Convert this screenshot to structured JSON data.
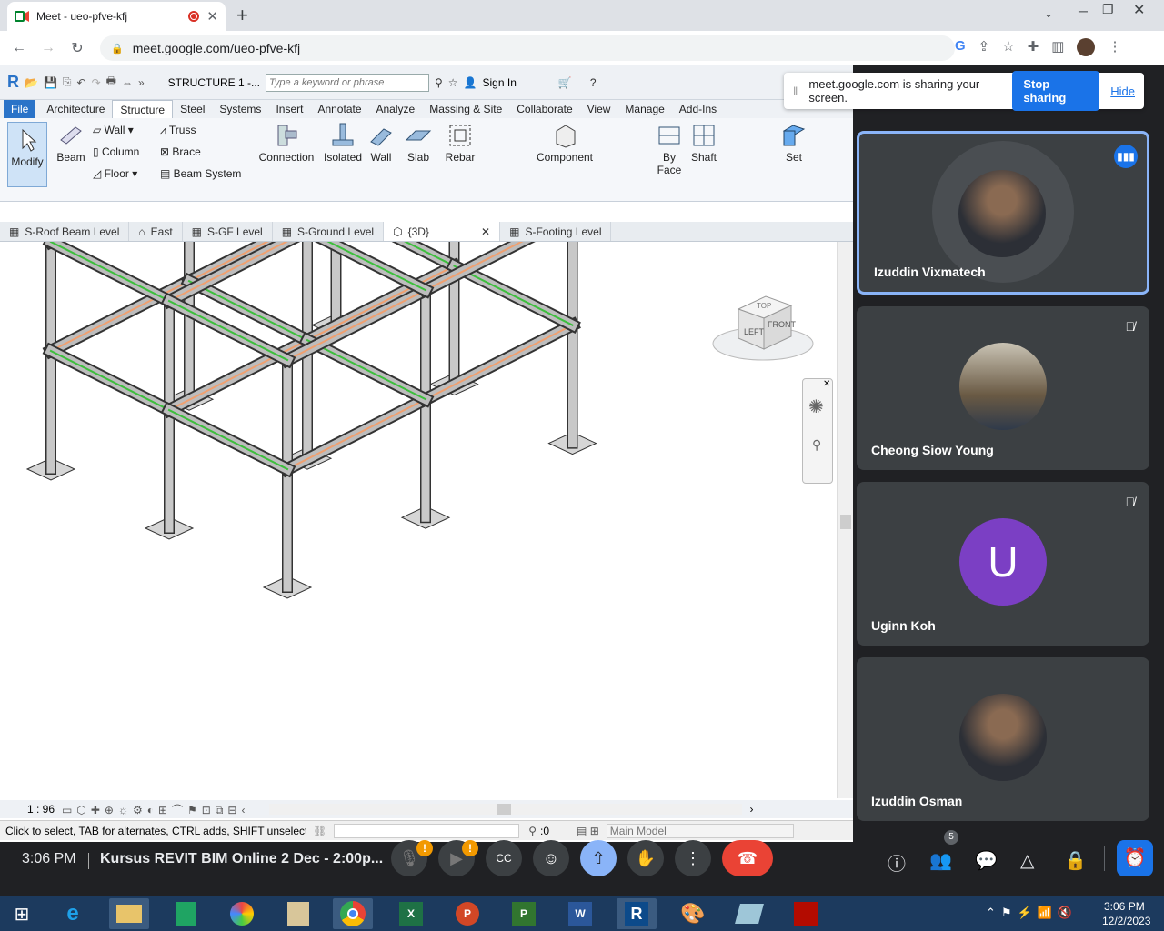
{
  "browser": {
    "tab_title": "Meet - ueo-pfve-kfj",
    "url": "meet.google.com/ueo-pfve-kfj",
    "new_tab": "+",
    "profile_initial": ""
  },
  "revit": {
    "doc_title": "STRUCTURE 1 -...",
    "search_placeholder": "Type a keyword or phrase",
    "sign_in": "Sign In",
    "menu_tabs": [
      "File",
      "Architecture",
      "Structure",
      "Steel",
      "Systems",
      "Insert",
      "Annotate",
      "Analyze",
      "Massing & Site",
      "Collaborate",
      "View",
      "Manage",
      "Add-Ins"
    ],
    "active_tab": "Structure",
    "ribbon": {
      "modify": "Modify",
      "beam": "Beam",
      "wall": "Wall",
      "column": "Column",
      "floor": "Floor",
      "truss": "Truss",
      "brace": "Brace",
      "beam_system": "Beam  System",
      "connection": "Connection",
      "isolated": "Isolated",
      "wall_found": "Wall",
      "slab": "Slab",
      "rebar": "Rebar",
      "component": "Component",
      "by_face": "By Face",
      "shaft": "Shaft",
      "set": "Set"
    },
    "view_tabs": [
      "S-Roof Beam Level",
      "East",
      "S-GF Level",
      "S-Ground Level",
      "{3D}",
      "S-Footing Level"
    ],
    "active_view": "{3D}",
    "scale": "1 : 96",
    "status_text": "Click to select, TAB for alternates, CTRL adds, SHIFT unselects",
    "count": ":0",
    "model": "Main Model",
    "viewcube_left": "LEFT",
    "viewcube_front": "FRONT",
    "viewcube_top": "TOP"
  },
  "meet": {
    "share_text": "meet.google.com is sharing your screen.",
    "stop_sharing": "Stop sharing",
    "hide": "Hide",
    "participants": [
      {
        "name": "Izuddin Vixmatech",
        "speaking": true
      },
      {
        "name": "Cheong Siow Young",
        "muted": true
      },
      {
        "name": "Uginn Koh",
        "muted": true,
        "initial": "U"
      },
      {
        "name": "Izuddin Osman"
      }
    ],
    "time": "3:06 PM",
    "meeting_title": "Kursus REVIT BIM Online 2 Dec - 2:00p...",
    "people_count": "5",
    "colors": {
      "end_call": "#ea4335",
      "present": "#8ab4f8",
      "avatar_u": "#7b3fc4",
      "accent": "#1a73e8"
    }
  },
  "taskbar": {
    "time": "3:06 PM",
    "date": "12/2/2023"
  }
}
